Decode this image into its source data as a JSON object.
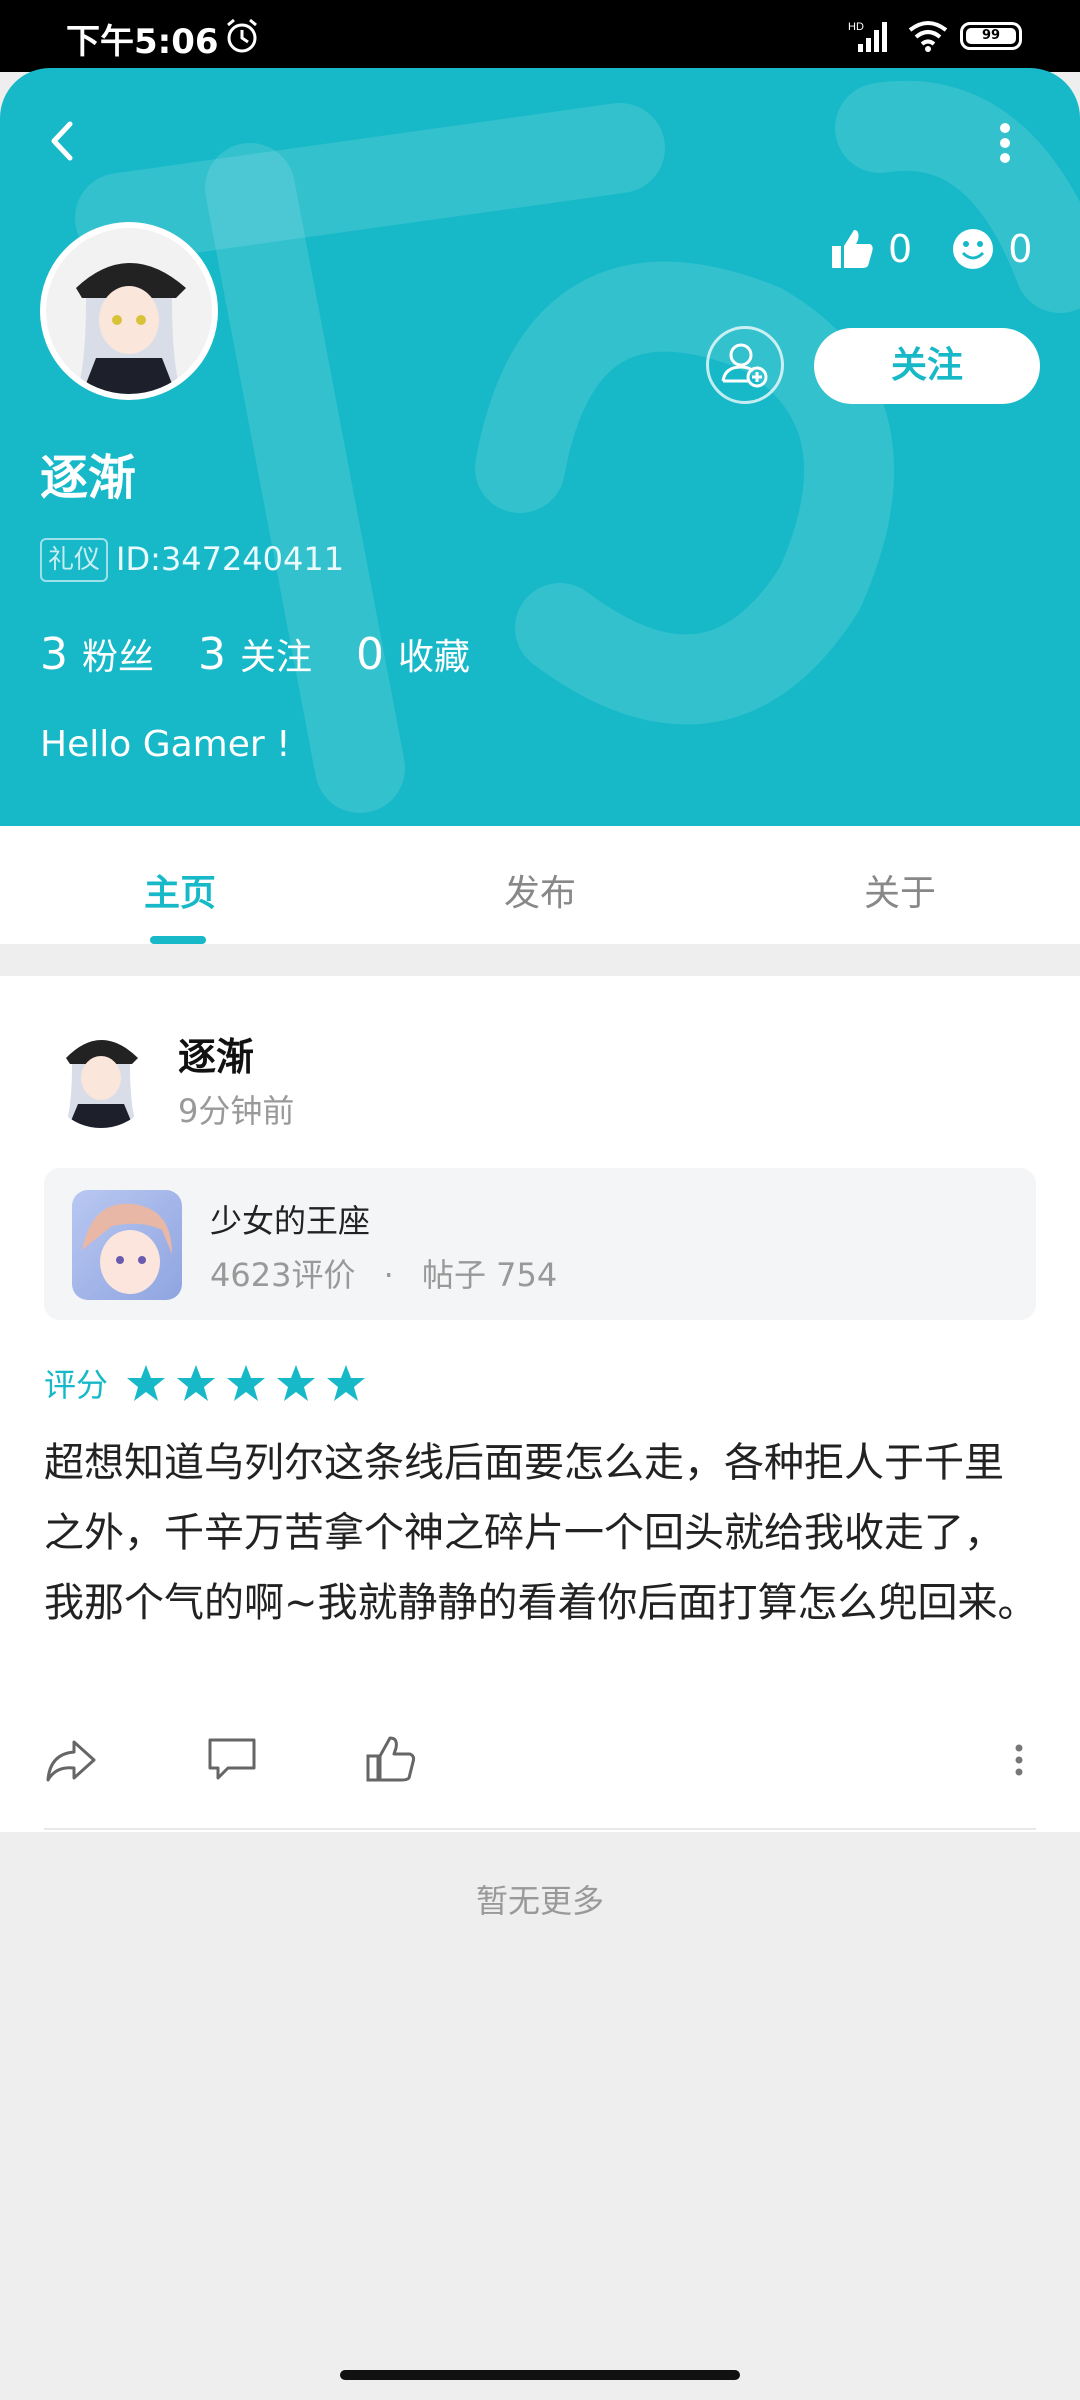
{
  "status_bar": {
    "time": "下午5:06",
    "battery": "99",
    "network_tag": "HD"
  },
  "profile": {
    "username": "逐渐",
    "badge": "礼仪",
    "id_text": "ID:347240411",
    "stats": [
      {
        "num": "3",
        "label": "粉丝"
      },
      {
        "num": "3",
        "label": "关注"
      },
      {
        "num": "0",
        "label": "收藏"
      }
    ],
    "bio": "Hello Gamer !",
    "likes": "0",
    "smiles": "0",
    "follow_label": "关注",
    "accent": "#17b9c8"
  },
  "tabs": [
    "主页",
    "发布",
    "关于"
  ],
  "post": {
    "username": "逐渐",
    "time": "9分钟前",
    "game": {
      "title": "少女的王座",
      "reviews": "4623评价",
      "posts": "帖子 754",
      "separator": "·"
    },
    "rating_label": "评分",
    "stars": 5,
    "content": "超想知道乌列尔这条线后面要怎么走，各种拒人于千里之外，千辛万苦拿个神之碎片一个回头就给我收走了，我那个气的啊~我就静静的看着你后面打算怎么兜回来。"
  },
  "footer_text": "暂无更多"
}
